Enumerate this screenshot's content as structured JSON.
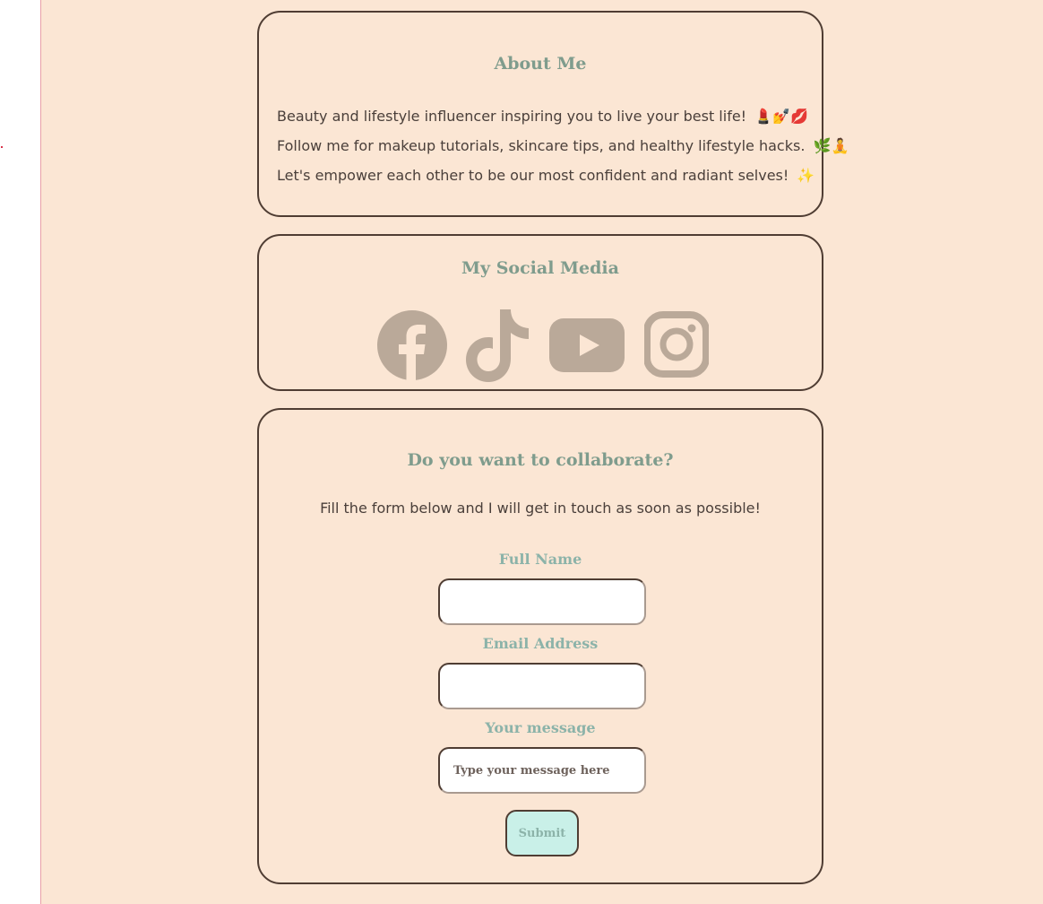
{
  "colors": {
    "background": "#fbe6d4",
    "card_border": "#4f3d33",
    "heading": "#7f9c8d",
    "label": "#8cb3a9",
    "body_text": "#4a3f3a",
    "icon": "#baa999",
    "submit_bg": "#c9f0e8"
  },
  "about": {
    "title": "About Me",
    "lines": [
      {
        "text": "Beauty and lifestyle influencer inspiring you to live your best life!",
        "emoji": "💄💅💋"
      },
      {
        "text": "Follow me for makeup tutorials, skincare tips, and healthy lifestyle hacks.",
        "emoji": "🌿🧘"
      },
      {
        "text": "Let's empower each other to be our most confident and radiant selves!",
        "emoji": "✨"
      }
    ]
  },
  "social": {
    "title": "My Social Media",
    "icons": [
      "facebook-icon",
      "tiktok-icon",
      "youtube-icon",
      "instagram-icon"
    ]
  },
  "collab": {
    "title": "Do you want to collaborate?",
    "subtitle": "Fill the form below and I will get in touch as soon as possible!",
    "fields": {
      "full_name": {
        "label": "Full Name",
        "value": "",
        "placeholder": ""
      },
      "email": {
        "label": "Email Address",
        "value": "",
        "placeholder": ""
      },
      "message": {
        "label": "Your message",
        "value": "",
        "placeholder": "Type your message here"
      }
    },
    "submit_label": "Submit"
  }
}
